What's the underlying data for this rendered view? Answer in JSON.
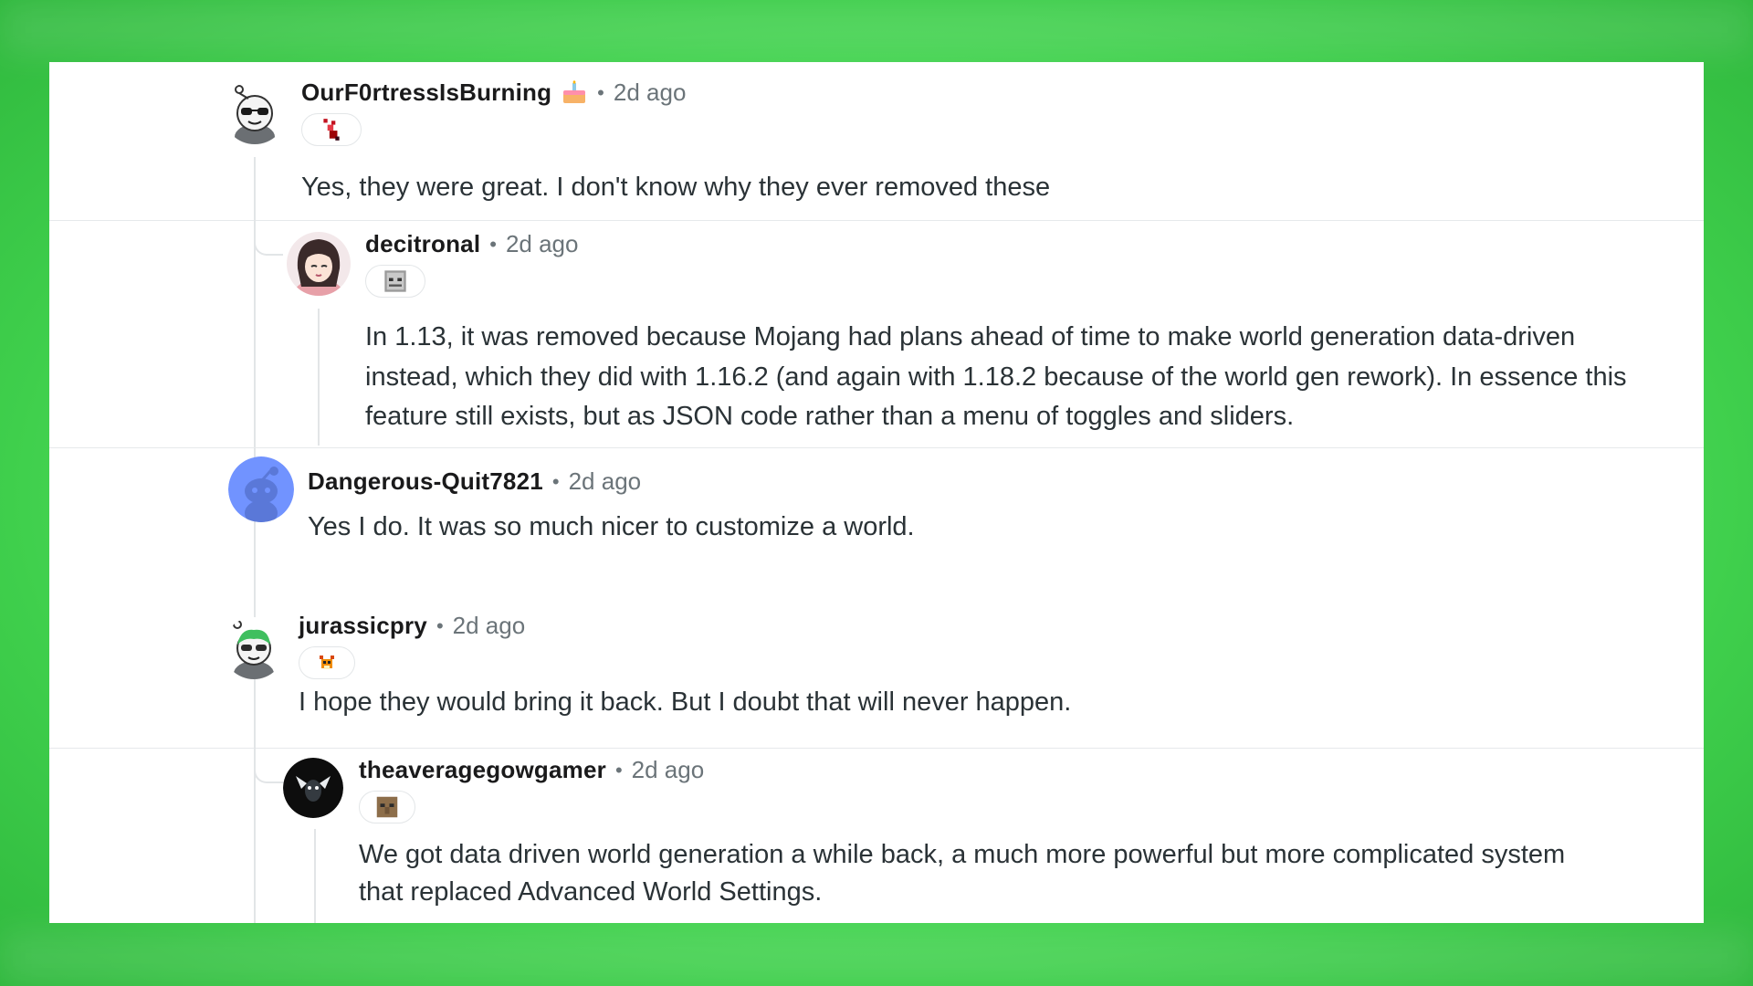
{
  "comments": [
    {
      "username": "OurF0rtressIsBurning",
      "separator": "•",
      "time": "2d ago",
      "body": "Yes, they were great. I don't know why they ever removed these",
      "flair_icon": "pixel-red-figure-icon",
      "badge_icon": "cake-icon"
    },
    {
      "username": "decitronal",
      "separator": "•",
      "time": "2d ago",
      "body": "In 1.13, it was removed because Mojang had plans ahead of time to make world generation data-driven instead, which they did with 1.16.2 (and again with 1.18.2 because of the world gen rework). In essence this feature still exists, but as JSON code rather than a menu of toggles and sliders.",
      "flair_icon": "pixel-skeleton-face-icon"
    },
    {
      "username": "Dangerous-Quit7821",
      "separator": "•",
      "time": "2d ago",
      "body": "Yes I do. It was so much nicer to customize a world."
    },
    {
      "username": "jurassicpry",
      "separator": "•",
      "time": "2d ago",
      "body": "I hope they would bring it back. But I doubt that will never happen.",
      "flair_icon": "pixel-fox-icon"
    },
    {
      "username": "theaveragegowgamer",
      "separator": "•",
      "time": "2d ago",
      "body": "We got data driven world generation a while back, a much more powerful but more complicated system that replaced Advanced World Settings.",
      "flair_icon": "pixel-villager-face-icon"
    }
  ],
  "colors": {
    "background": "#5fe56a",
    "panel": "#ffffff",
    "username": "#1a1a1b",
    "meta": "#6b7479",
    "body": "#2a3236",
    "thread_line": "#e2e5e7"
  }
}
